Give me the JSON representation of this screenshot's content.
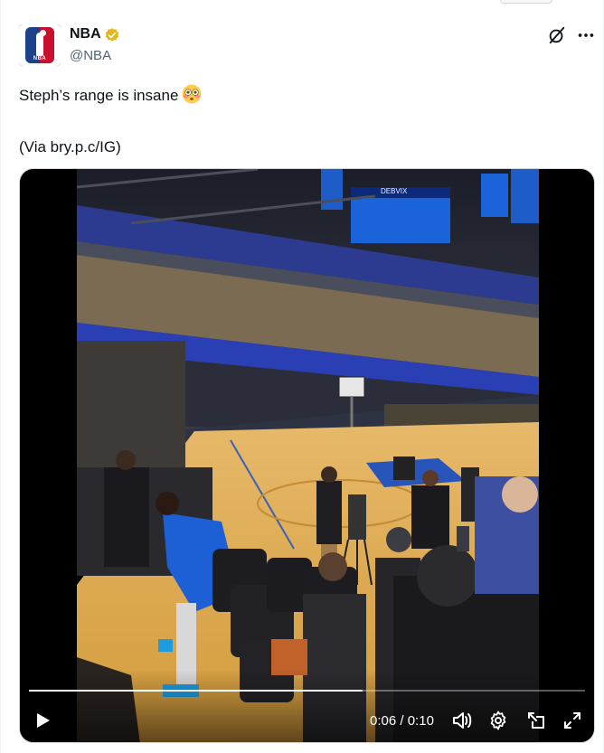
{
  "author": {
    "name": "NBA",
    "handle": "@NBA",
    "logo_text": "NBA"
  },
  "tweet": {
    "line1": "Steph’s range is insane",
    "line2": "(Via bry.p.c/IG)"
  },
  "icons": {
    "verified": "verified-badge-icon",
    "emoji": "flushed-face-emoji",
    "grok": "grok-icon",
    "more": "more-icon",
    "play": "play-icon",
    "volume": "volume-icon",
    "settings": "gear-icon",
    "pip": "picture-in-picture-icon",
    "fullscreen": "fullscreen-icon"
  },
  "video": {
    "current_time": "0:06",
    "duration": "0:10",
    "time_separator": " / ",
    "progress": 0.6,
    "scoreboard_text": "DEBVIX"
  },
  "colors": {
    "verified": "#e2b719",
    "court": "#e8b85a",
    "jersey": "#1d5fd4",
    "arena_blue": "#1f3fb0",
    "text_secondary": "#536471"
  }
}
